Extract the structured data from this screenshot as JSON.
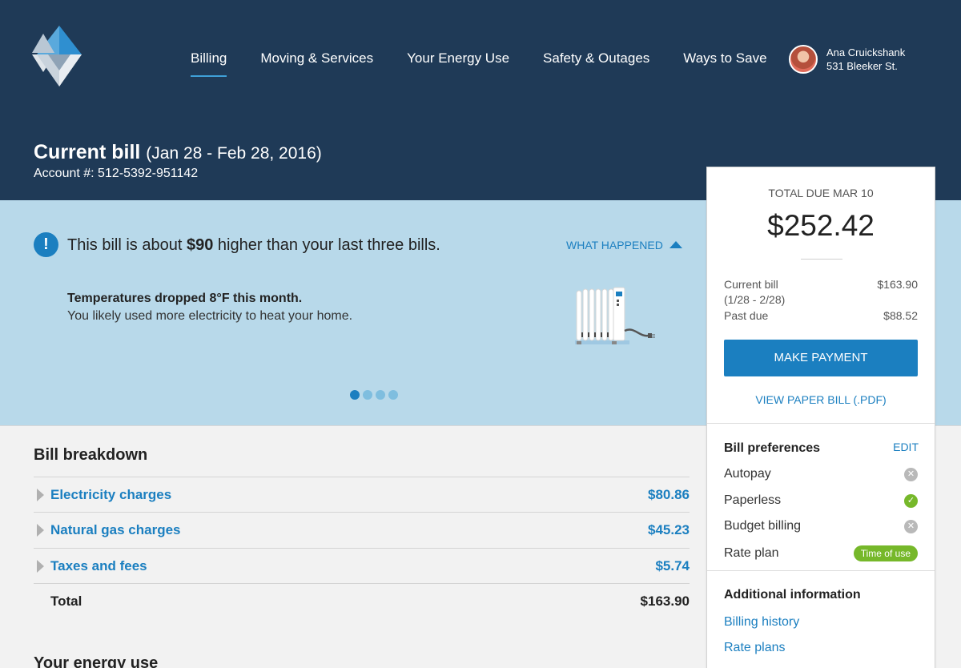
{
  "brand": {
    "accent": "#1b7fc0",
    "header_bg": "#1f3a57",
    "alert_bg": "#b8d9ea",
    "success": "#76b82a"
  },
  "nav": {
    "items": [
      {
        "label": "Billing",
        "active": true
      },
      {
        "label": "Moving & Services"
      },
      {
        "label": "Your Energy Use"
      },
      {
        "label": "Safety & Outages"
      },
      {
        "label": "Ways to Save"
      }
    ]
  },
  "user": {
    "name": "Ana Cruickshank",
    "address": "531 Bleeker St."
  },
  "bill": {
    "title": "Current bill",
    "dates": "(Jan 28 - Feb 28, 2016)",
    "account": "Account #: 512-5392-951142"
  },
  "alert": {
    "icon": "exclamation-icon",
    "text_before": "This bill is about ",
    "text_bold": "$90",
    "text_after": " higher than your last three bills.",
    "toggle_label": "WHAT HAPPENED",
    "headline": "Temperatures dropped 8°F this month.",
    "detail": "You likely used more electricity to heat your home.",
    "slides": 4,
    "active_slide": 1
  },
  "breakdown": {
    "title": "Bill breakdown",
    "rows": [
      {
        "label": "Electricity charges",
        "amount": "$80.86"
      },
      {
        "label": "Natural gas charges",
        "amount": "$45.23"
      },
      {
        "label": "Taxes and fees",
        "amount": "$5.74"
      }
    ],
    "total_label": "Total",
    "total_amount": "$163.90"
  },
  "energy": {
    "title": "Your energy use"
  },
  "summary": {
    "due_label": "TOTAL DUE MAR 10",
    "due_amount": "$252.42",
    "current_label": "Current bill",
    "current_range": "(1/28 - 2/28)",
    "current_value": "$163.90",
    "past_label": "Past due",
    "past_value": "$88.52",
    "pay_button": "MAKE PAYMENT",
    "pdf_link": "VIEW PAPER BILL (.PDF)"
  },
  "preferences": {
    "title": "Bill preferences",
    "edit": "EDIT",
    "items": [
      {
        "label": "Autopay",
        "status": "off"
      },
      {
        "label": "Paperless",
        "status": "on"
      },
      {
        "label": "Budget billing",
        "status": "off"
      },
      {
        "label": "Rate plan",
        "badge": "Time of use"
      }
    ]
  },
  "additional": {
    "title": "Additional information",
    "links": [
      "Billing history",
      "Rate plans"
    ]
  }
}
